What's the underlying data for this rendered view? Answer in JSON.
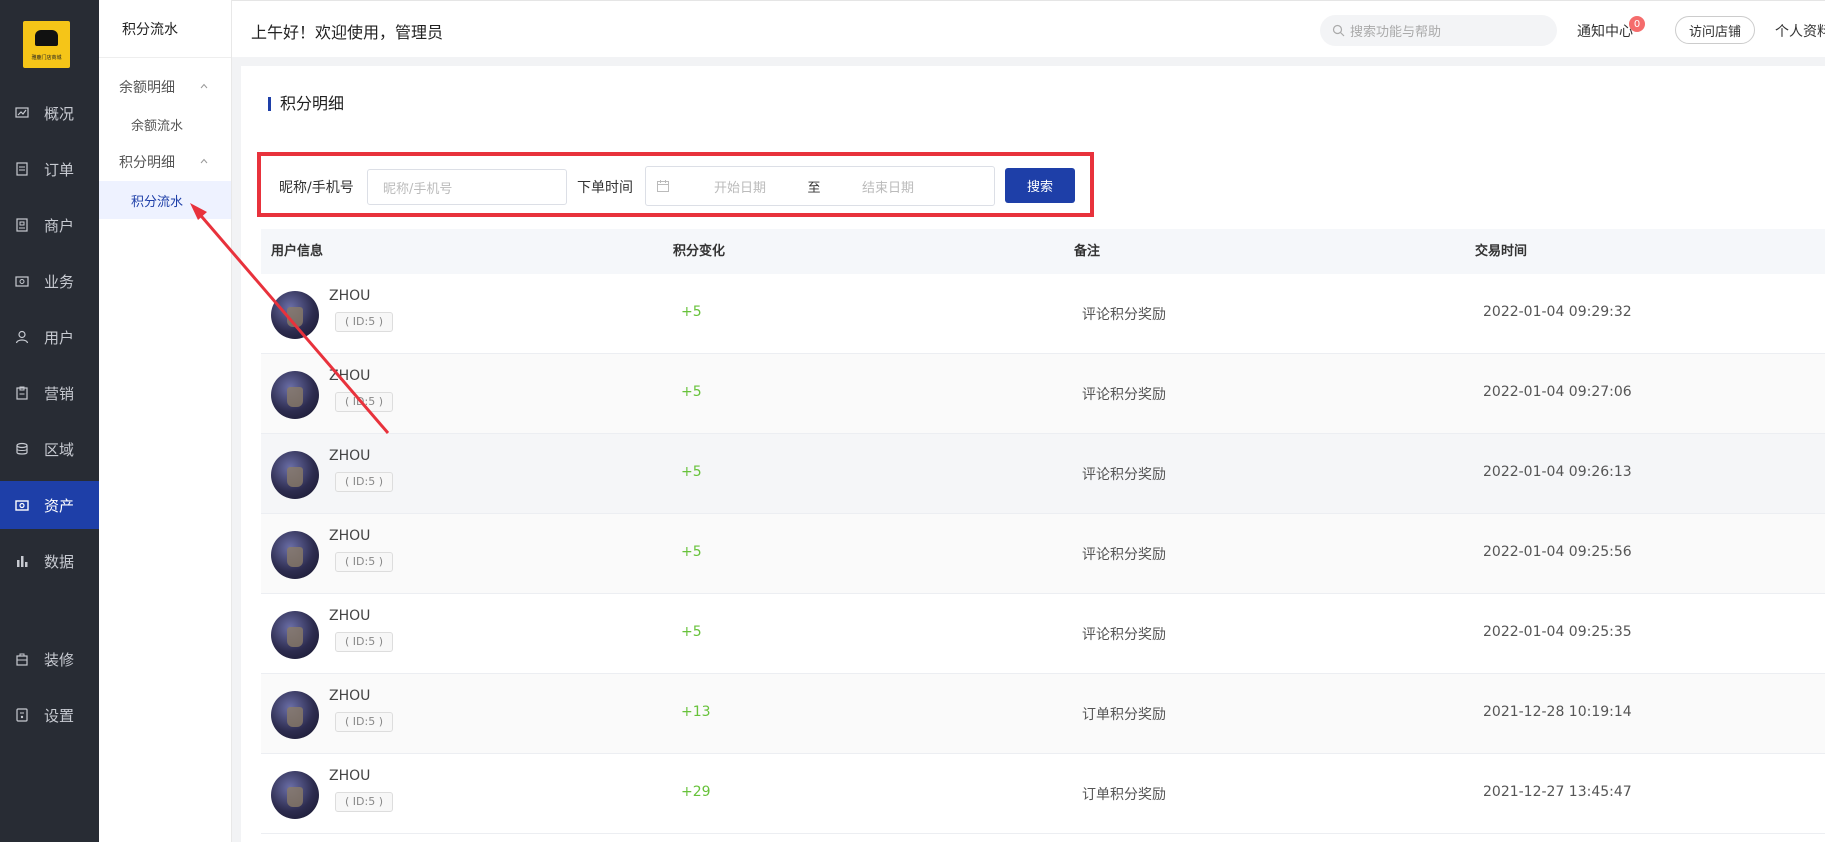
{
  "app": {
    "logo_text": "雅鹿门店商城",
    "greeting": "上午好！欢迎使用，管理员"
  },
  "nav": {
    "items": [
      {
        "label": "概况",
        "icon": "trend-icon"
      },
      {
        "label": "订单",
        "icon": "order-icon"
      },
      {
        "label": "商户",
        "icon": "store-icon"
      },
      {
        "label": "业务",
        "icon": "business-icon"
      },
      {
        "label": "用户",
        "icon": "user-icon"
      },
      {
        "label": "营销",
        "icon": "marketing-icon"
      },
      {
        "label": "区域",
        "icon": "region-icon"
      },
      {
        "label": "资产",
        "icon": "asset-icon",
        "active": true
      },
      {
        "label": "数据",
        "icon": "chart-icon"
      },
      {
        "label": "装修",
        "icon": "decorate-icon"
      },
      {
        "label": "设置",
        "icon": "settings-icon"
      }
    ]
  },
  "subnav": {
    "title": "积分流水",
    "groups": [
      {
        "label": "余额明细",
        "items": [
          {
            "label": "余额流水"
          }
        ]
      },
      {
        "label": "积分明细",
        "items": [
          {
            "label": "积分流水",
            "active": true
          }
        ]
      }
    ]
  },
  "header": {
    "search_placeholder": "搜索功能与帮助",
    "notice_label": "通知中心",
    "notice_count": "0",
    "visit_store_label": "访问店铺",
    "profile_label": "个人资料"
  },
  "main": {
    "section_title": "积分明细",
    "filter": {
      "name_label": "昵称/手机号",
      "name_placeholder": "昵称/手机号",
      "time_label": "下单时间",
      "start_placeholder": "开始日期",
      "range_sep": "至",
      "end_placeholder": "结束日期",
      "search_button": "搜索"
    },
    "table": {
      "columns": [
        "用户信息",
        "积分变化",
        "备注",
        "交易时间"
      ],
      "rows": [
        {
          "name": "ZHOU",
          "id": "( ID:5 )",
          "delta": "+5",
          "note": "评论积分奖励",
          "time": "2022-01-04 09:29:32"
        },
        {
          "name": "ZHOU",
          "id": "( ID:5 )",
          "delta": "+5",
          "note": "评论积分奖励",
          "time": "2022-01-04 09:27:06"
        },
        {
          "name": "ZHOU",
          "id": "( ID:5 )",
          "delta": "+5",
          "note": "评论积分奖励",
          "time": "2022-01-04 09:26:13"
        },
        {
          "name": "ZHOU",
          "id": "( ID:5 )",
          "delta": "+5",
          "note": "评论积分奖励",
          "time": "2022-01-04 09:25:56"
        },
        {
          "name": "ZHOU",
          "id": "( ID:5 )",
          "delta": "+5",
          "note": "评论积分奖励",
          "time": "2022-01-04 09:25:35"
        },
        {
          "name": "ZHOU",
          "id": "( ID:5 )",
          "delta": "+13",
          "note": "订单积分奖励",
          "time": "2021-12-28 10:19:14"
        },
        {
          "name": "ZHOU",
          "id": "( ID:5 )",
          "delta": "+29",
          "note": "订单积分奖励",
          "time": "2021-12-27 13:45:47"
        }
      ]
    }
  },
  "colors": {
    "nav_bg": "#282c34",
    "active": "#1e3fa8",
    "highlight_box": "#e8323c",
    "annotation_arrow": "#e8323c",
    "positive_delta": "#67c23a"
  }
}
